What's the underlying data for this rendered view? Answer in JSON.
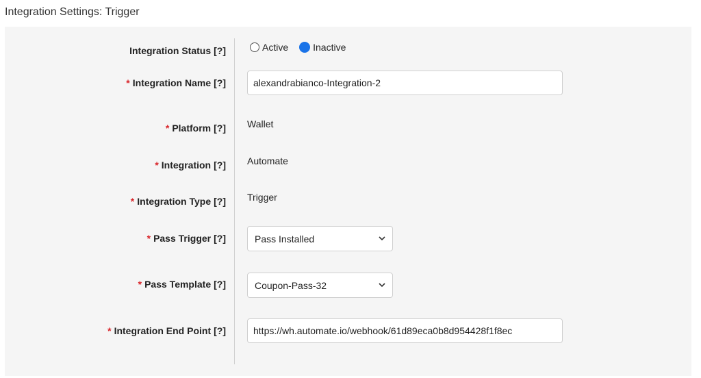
{
  "section_title": "Integration Settings: Trigger",
  "help_marker": "[?]",
  "required_marker": "*",
  "colors": {
    "required": "#d9262b",
    "radio_selected": "#1a73e8",
    "panel_bg": "#f5f5f5"
  },
  "fields": {
    "status": {
      "label": "Integration Status",
      "options": [
        "Active",
        "Inactive"
      ],
      "selected": "Inactive"
    },
    "name": {
      "label": "Integration Name",
      "value": "alexandrabianco-Integration-2"
    },
    "platform": {
      "label": "Platform",
      "value": "Wallet"
    },
    "integration": {
      "label": "Integration",
      "value": "Automate"
    },
    "type": {
      "label": "Integration Type",
      "value": "Trigger"
    },
    "pass_trigger": {
      "label": "Pass Trigger",
      "value": "Pass Installed"
    },
    "pass_template": {
      "label": "Pass Template",
      "value": "Coupon-Pass-32"
    },
    "end_point": {
      "label": "Integration End Point",
      "value": "https://wh.automate.io/webhook/61d89eca0b8d954428f1f8ec"
    }
  },
  "icons": {
    "select_arrow": "chevron-down-icon"
  }
}
